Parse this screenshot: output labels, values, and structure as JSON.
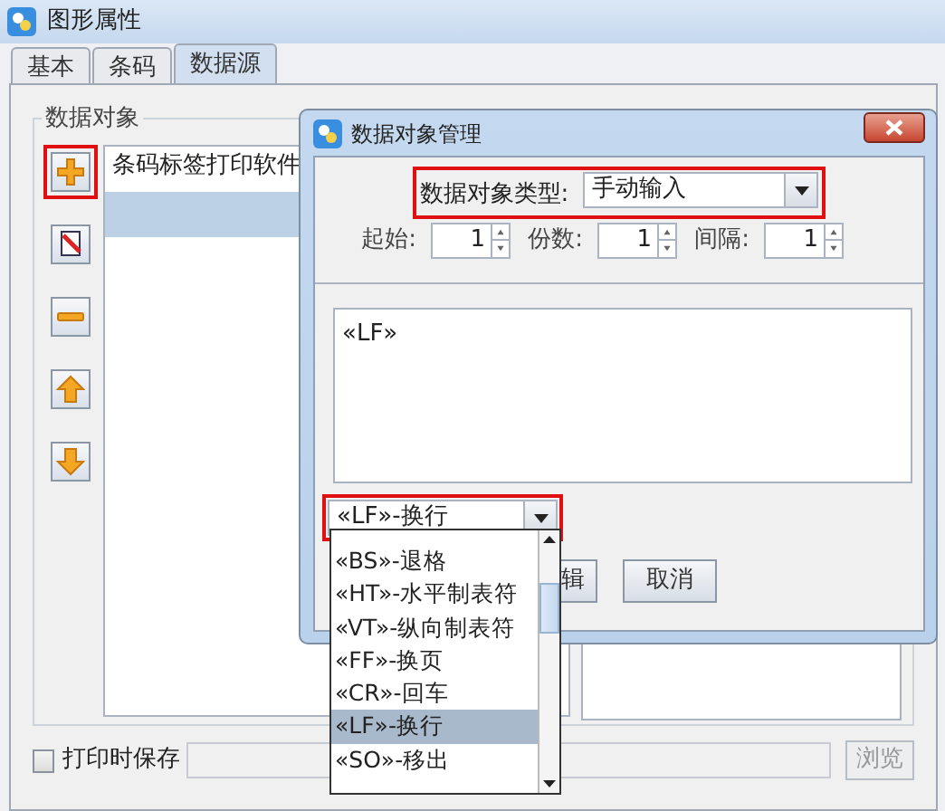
{
  "window": {
    "title": "图形属性"
  },
  "tabs": [
    {
      "label": "基本",
      "selected": false
    },
    {
      "label": "条码",
      "selected": false
    },
    {
      "label": "数据源",
      "selected": true
    }
  ],
  "group": {
    "title": "数据对象"
  },
  "tool_buttons": [
    {
      "kind": "add",
      "highlighted": true
    },
    {
      "kind": "edit",
      "highlighted": false
    },
    {
      "kind": "remove",
      "highlighted": false
    },
    {
      "kind": "up",
      "highlighted": false
    },
    {
      "kind": "down",
      "highlighted": false
    }
  ],
  "list": {
    "items": [
      {
        "label": "条码标签打印软件",
        "selected": false
      },
      {
        "selected": true
      }
    ]
  },
  "dialog": {
    "title": "数据对象管理",
    "type_label": "数据对象类型:",
    "type_value": "手动输入",
    "type_highlighted": true,
    "spinners": [
      {
        "label": "起始:",
        "value": "1"
      },
      {
        "label": "份数:",
        "value": "1"
      },
      {
        "label": "间隔:",
        "value": "1"
      }
    ],
    "text": "«LF»",
    "char_combo": {
      "value": "«LF»-换行",
      "highlighted": true
    },
    "char_options": [
      {
        "label": "«BS»-退格",
        "selected": false
      },
      {
        "label": "«HT»-水平制表符",
        "selected": false
      },
      {
        "label": "«VT»-纵向制表符",
        "selected": false
      },
      {
        "label": "«FF»-换页",
        "selected": false
      },
      {
        "label": "«CR»-回车",
        "selected": false
      },
      {
        "label": "«LF»-换行",
        "selected": true
      },
      {
        "label": "«SO»-移出",
        "selected": false
      }
    ],
    "buttons": [
      "辑",
      "取消"
    ]
  },
  "save_on_print": {
    "label": "打印时保存",
    "checked": false
  },
  "browse_button": {
    "label": "浏览",
    "disabled": true
  }
}
